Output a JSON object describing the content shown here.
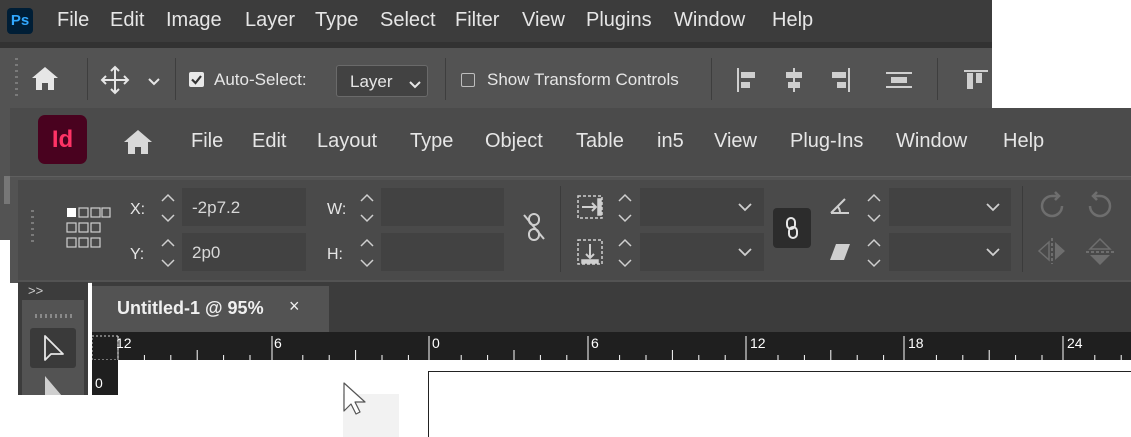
{
  "photoshop": {
    "logo": "Ps",
    "menu": [
      "File",
      "Edit",
      "Image",
      "Layer",
      "Type",
      "Select",
      "Filter",
      "View",
      "Plugins",
      "Window",
      "Help"
    ],
    "options": {
      "auto_select_label": "Auto-Select:",
      "auto_select_checked": true,
      "layer_select_value": "Layer",
      "show_transform_label": "Show Transform Controls",
      "show_transform_checked": false
    }
  },
  "indesign": {
    "logo": "Id",
    "menu": [
      "File",
      "Edit",
      "Layout",
      "Type",
      "Object",
      "Table",
      "in5",
      "View",
      "Plug-Ins",
      "Window",
      "Help"
    ],
    "control": {
      "x_label": "X:",
      "x_value": "-2p7.2",
      "y_label": "Y:",
      "y_value": "2p0",
      "w_label": "W:",
      "w_value": "",
      "h_label": "H:",
      "h_value": ""
    },
    "tools_collapse": ">>",
    "document_tab": {
      "title": "Untitled-1 @ 95%",
      "close": "×"
    },
    "ruler": {
      "labels": [
        "12",
        "6",
        "0",
        "6",
        "12",
        "18",
        "24"
      ],
      "vertical_label": "0"
    }
  },
  "colors": {
    "ps_brand_bg": "#001e36",
    "ps_brand_fg": "#31a8ff",
    "id_brand_bg": "#49021f",
    "id_brand_fg": "#ff3366"
  }
}
